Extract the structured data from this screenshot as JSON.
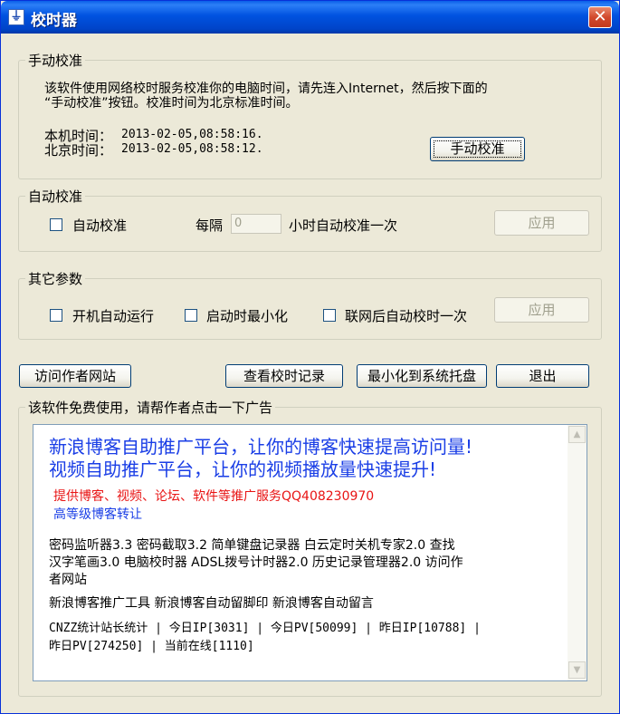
{
  "window": {
    "title": "校时器",
    "icon": "clock-icon",
    "close_glyph": "✕"
  },
  "manual": {
    "legend": "手动校准",
    "desc_line1": "该软件使用网络校时服务校准你的电脑时间，请先连入Internet，然后按下面的",
    "desc_line2": "“手动校准”按钮。校准时间为北京标准时间。",
    "local_label": "本机时间：",
    "local_value": "2013-02-05,08:58:16.",
    "beijing_label": "北京时间：",
    "beijing_value": "2013-02-05,08:58:12.",
    "button_label": "手动校准"
  },
  "auto": {
    "legend": "自动校准",
    "checkbox_label": "自动校准",
    "checked": false,
    "interval_prefix": "每隔",
    "interval_value": "0",
    "interval_suffix": "小时自动校准一次",
    "apply_label": "应用"
  },
  "other": {
    "legend": "其它参数",
    "options": [
      {
        "label": "开机自动运行",
        "checked": false
      },
      {
        "label": "启动时最小化",
        "checked": false
      },
      {
        "label": "联网后自动校时一次",
        "checked": false
      }
    ],
    "apply_label": "应用"
  },
  "actions": {
    "visit_author": "访问作者网站",
    "view_log": "查看校时记录",
    "minimize_tray": "最小化到系统托盘",
    "exit": "退出"
  },
  "ads": {
    "legend": "该软件免费使用，请帮作者点击一下广告",
    "big_line1": "新浪博客自助推广平台，让你的博客快速提高访问量!",
    "big_line2": "视频自助推广平台，让你的视频播放量快速提升!",
    "red_line": "提供博客、视频、论坛、软件等推广服务QQ408230970",
    "blue_line": "高等级博客转让",
    "links_line1": "密码监听器3.3 密码截取3.2 简单键盘记录器 白云定时关机专家2.0 查找",
    "links_line2": "汉字笔画3.0 电脑校时器 ADSL拨号计时器2.0 历史记录管理器2.0 访问作",
    "links_line3": "者网站",
    "sina_line": "新浪博客推广工具 新浪博客自动留脚印 新浪博客自动留言",
    "stats_line1": "CNZZ统计站长统计 | 今日IP[3031] | 今日PV[50099] | 昨日IP[10788] |",
    "stats_line2": "昨日PV[274250] | 当前在线[1110]"
  }
}
